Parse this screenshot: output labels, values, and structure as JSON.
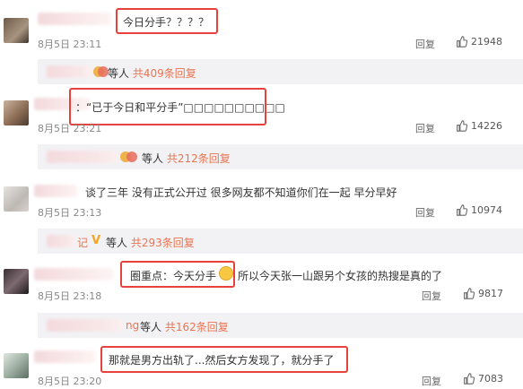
{
  "comments": [
    {
      "text": "今日分手？？？？",
      "time": "8月5日 23:11",
      "reply_label": "回复",
      "likes": "21948",
      "sub": {
        "suffix": "等人",
        "count": "共409条回复"
      }
    },
    {
      "text": "：“已于今日和平分手”□□□□□□□□□□",
      "time": "8月5日 23:21",
      "reply_label": "回复",
      "likes": "14226",
      "sub": {
        "suffix": "等人",
        "count": "共212条回复"
      }
    },
    {
      "text": "谈了三年 没有正式公开过  很多网友都不知道你们在一起 早分早好",
      "time": "8月5日 23:13",
      "reply_label": "回复",
      "likes": "10974",
      "sub": {
        "name_tail": "记",
        "suffix": "等人",
        "count": "共293条回复"
      }
    },
    {
      "prefix": "圈重点：今天分手",
      "text": "所以今天张一山跟另个女孩的热搜是真的了",
      "time": "8月5日 23:18",
      "reply_label": "回复",
      "likes": "9817",
      "sub": {
        "name_tail": "ng",
        "suffix": "等人",
        "count": "共162条回复"
      }
    },
    {
      "text": "那就是男方出轨了...然后女方发现了，就分手了",
      "time": "8月5日 23:20",
      "reply_label": "回复",
      "likes": "7083"
    }
  ],
  "colors": {
    "highlight_box": "#e8413b",
    "reply_count": "#eb7350",
    "subbar_bg": "#f2f2f5"
  },
  "icons": {
    "like": "thumbs-up-icon",
    "verified": "verified-v-icon",
    "emoji": "thinking-emoji-icon"
  }
}
